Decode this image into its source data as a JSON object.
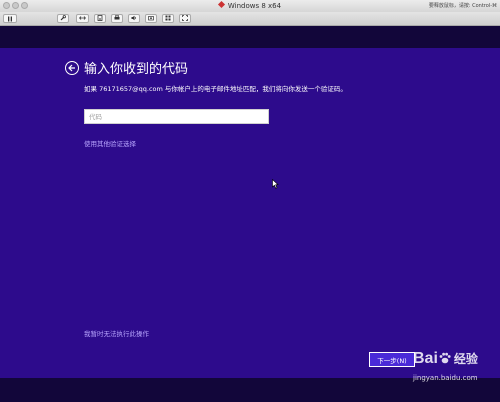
{
  "window": {
    "title": "Windows 8 x64",
    "release_hint": "要释放鼠标，请按: Control-⌘"
  },
  "toolbar": {
    "icons": [
      "pause-icon",
      "wrench-icon",
      "arrows-icon",
      "drive-icon",
      "printer-icon",
      "speaker-icon",
      "camera-icon",
      "grid-icon",
      "fullscreen-icon"
    ]
  },
  "page": {
    "title": "输入你收到的代码",
    "description": "如果 76171657@qq.com 与你帐户上的电子邮件地址匹配，我们将向你发送一个验证码。",
    "code_input": {
      "placeholder": "代码",
      "value": ""
    },
    "other_verification_link": "使用其他验证选择",
    "cannot_do_link": "我暂时无法执行此操作",
    "next_button": "下一步(N)"
  },
  "colors": {
    "background": "#2d0b8c",
    "link": "#b9a6ff",
    "button": "#4a2ad8"
  },
  "watermark": {
    "logo": "Bai",
    "logo_tail": "经验",
    "url": "jingyan.baidu.com"
  }
}
